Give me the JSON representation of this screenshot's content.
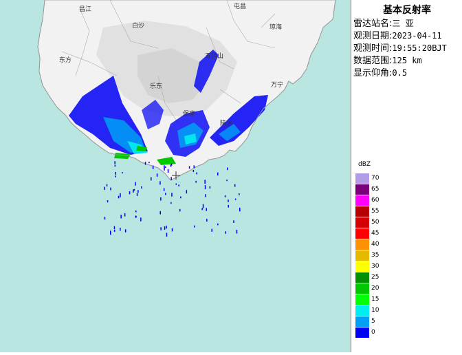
{
  "panel": {
    "title": "基本反射率",
    "rows": [
      {
        "label": "雷达站名:",
        "value": "三 亚"
      },
      {
        "label": "观测日期:",
        "value": "2023-04-11"
      },
      {
        "label": "观测时间:",
        "value": "19:55:20BJT"
      },
      {
        "label": "数据范围:",
        "value": "125 km"
      },
      {
        "label": "显示仰角:",
        "value": "0.5"
      }
    ]
  },
  "legend": {
    "unit": "dBZ",
    "levels": [
      {
        "label": "70",
        "color": "#b39be6"
      },
      {
        "label": "65",
        "color": "#7a007a"
      },
      {
        "label": "60",
        "color": "#ff00ff"
      },
      {
        "label": "55",
        "color": "#b40000"
      },
      {
        "label": "50",
        "color": "#d60000"
      },
      {
        "label": "45",
        "color": "#ff0000"
      },
      {
        "label": "40",
        "color": "#ff9000"
      },
      {
        "label": "35",
        "color": "#e6b800"
      },
      {
        "label": "30",
        "color": "#ffff00"
      },
      {
        "label": "25",
        "color": "#009000"
      },
      {
        "label": "20",
        "color": "#00c800"
      },
      {
        "label": "15",
        "color": "#00ff00"
      },
      {
        "label": "10",
        "color": "#00eeee"
      },
      {
        "label": "5",
        "color": "#00a0f6"
      },
      {
        "label": "0",
        "color": "#0000f6"
      }
    ]
  },
  "map": {
    "sea_color": "#b9e6e0",
    "land_color": "#f2f2f2",
    "places": [
      {
        "name": "昌江"
      },
      {
        "name": "屯昌"
      },
      {
        "name": "白沙"
      },
      {
        "name": "琼海"
      },
      {
        "name": "东方"
      },
      {
        "name": "五指山"
      },
      {
        "name": "乐东"
      },
      {
        "name": "保亭"
      },
      {
        "name": "陵水"
      },
      {
        "name": "万宁"
      }
    ]
  }
}
